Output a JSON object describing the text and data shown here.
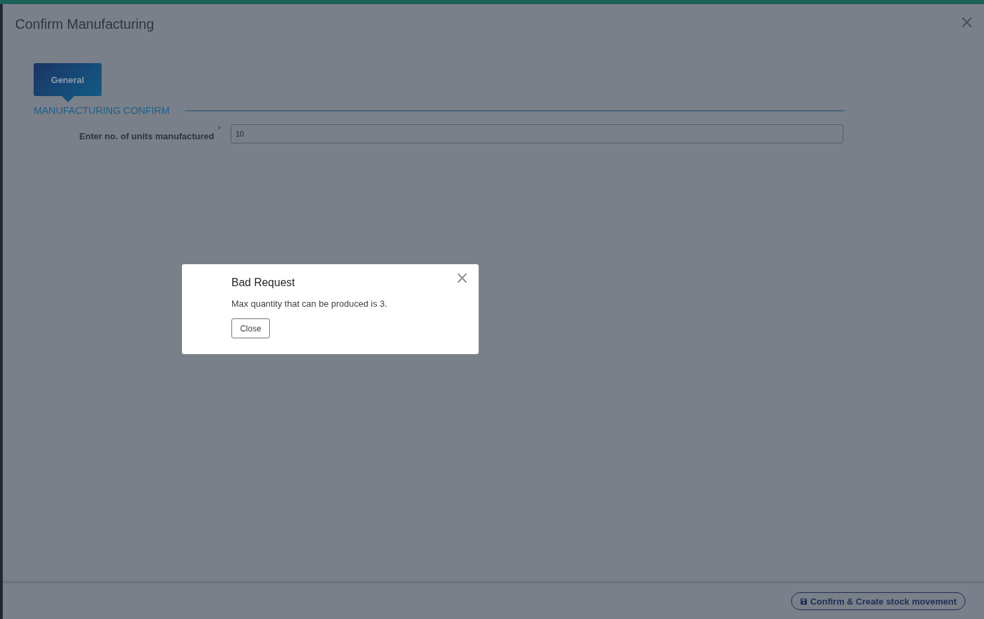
{
  "window": {
    "title": "Confirm Manufacturing",
    "close": "×"
  },
  "tabs": [
    {
      "label": "General",
      "selected": true
    }
  ],
  "section": {
    "title": "MANUFACTURING CONFIRM"
  },
  "fields": [
    {
      "label": "Enter no. of units manufactured",
      "required": true,
      "required_mark": "*",
      "value": "10"
    }
  ],
  "footer": {
    "button": "Confirm & Create stock movement"
  },
  "dialog": {
    "title": "Bad Request",
    "message": "Max quantity that can be produced is 3.",
    "button": "Close",
    "close": "×"
  }
}
